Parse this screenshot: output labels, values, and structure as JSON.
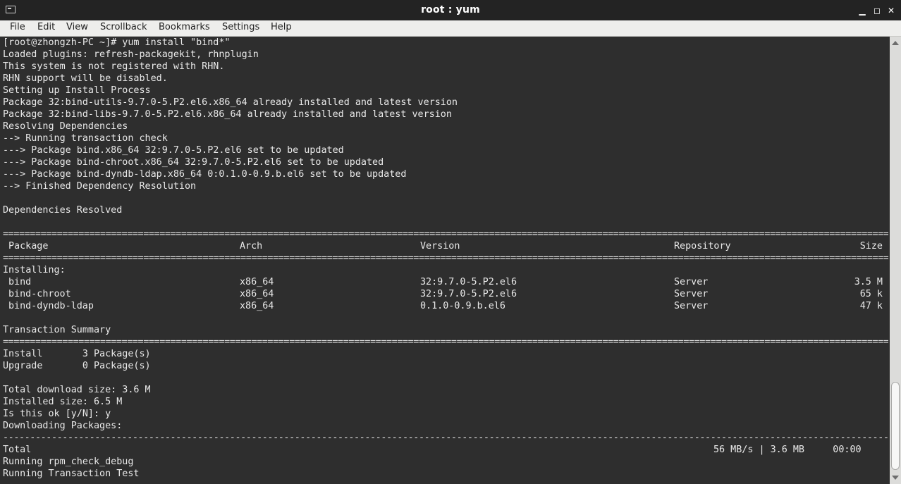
{
  "window": {
    "title": "root : yum",
    "controls": {
      "minimize": "▁",
      "maximize": "◻",
      "close": "✕"
    }
  },
  "menu": [
    "File",
    "Edit",
    "View",
    "Scrollback",
    "Bookmarks",
    "Settings",
    "Help"
  ],
  "terminal": {
    "lines": [
      "[root@zhongzh-PC ~]# yum install \"bind*\"",
      "Loaded plugins: refresh-packagekit, rhnplugin",
      "This system is not registered with RHN.",
      "RHN support will be disabled.",
      "Setting up Install Process",
      "Package 32:bind-utils-9.7.0-5.P2.el6.x86_64 already installed and latest version",
      "Package 32:bind-libs-9.7.0-5.P2.el6.x86_64 already installed and latest version",
      "Resolving Dependencies",
      "--> Running transaction check",
      "---> Package bind.x86_64 32:9.7.0-5.P2.el6 set to be updated",
      "---> Package bind-chroot.x86_64 32:9.7.0-5.P2.el6 set to be updated",
      "---> Package bind-dyndb-ldap.x86_64 0:0.1.0-0.9.b.el6 set to be updated",
      "--> Finished Dependency Resolution",
      "",
      "Dependencies Resolved"
    ],
    "table_header": {
      "package": "Package",
      "arch": "Arch",
      "version": "Version",
      "repository": "Repository",
      "size": "Size"
    },
    "installing_label": "Installing:",
    "packages": [
      {
        "name": "bind",
        "arch": "x86_64",
        "version": "32:9.7.0-5.P2.el6",
        "repo": "Server",
        "size": "3.5 M"
      },
      {
        "name": "bind-chroot",
        "arch": "x86_64",
        "version": "32:9.7.0-5.P2.el6",
        "repo": "Server",
        "size": "65 k"
      },
      {
        "name": "bind-dyndb-ldap",
        "arch": "x86_64",
        "version": "0.1.0-0.9.b.el6",
        "repo": "Server",
        "size": "47 k"
      }
    ],
    "transaction_summary": "Transaction Summary",
    "summary_lines": [
      "Install       3 Package(s)",
      "Upgrade       0 Package(s)"
    ],
    "tail_lines": [
      "Total download size: 3.6 M",
      "Installed size: 6.5 M",
      "Is this ok [y/N]: y",
      "Downloading Packages:"
    ],
    "total_label": "Total",
    "total_stats": "56 MB/s | 3.6 MB     00:00",
    "final_lines": [
      "Running rpm_check_debug",
      "Running Transaction Test"
    ]
  }
}
